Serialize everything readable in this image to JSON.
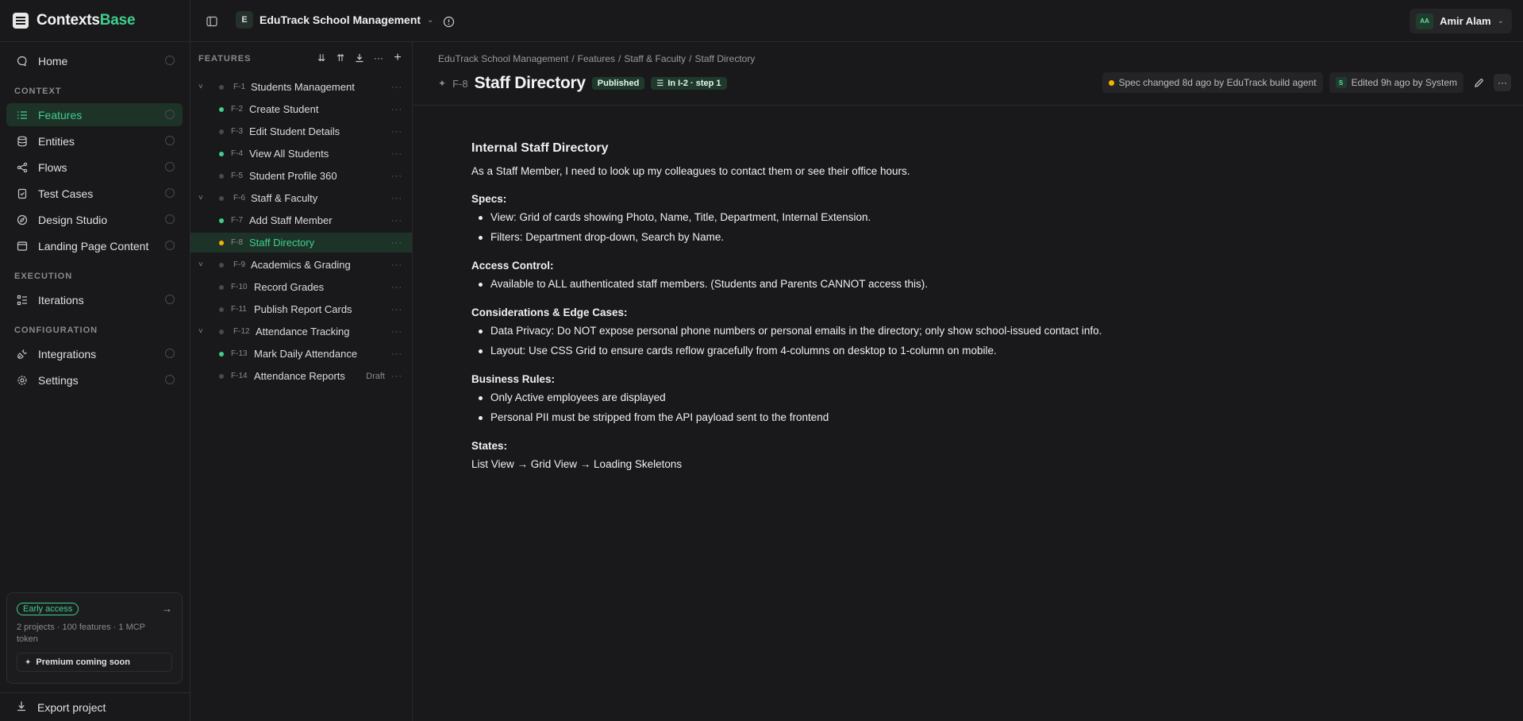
{
  "brand": {
    "name_main": "Contexts",
    "name_accent": "Base"
  },
  "project": {
    "badge": "E",
    "name": "EduTrack School Management"
  },
  "user": {
    "initials": "AA",
    "name": "Amir Alam"
  },
  "sidebar": {
    "home": "Home",
    "context_heading": "CONTEXT",
    "context_items": [
      "Features",
      "Entities",
      "Flows",
      "Test Cases",
      "Design Studio",
      "Landing Page Content"
    ],
    "execution_heading": "EXECUTION",
    "execution_items": [
      "Iterations"
    ],
    "configuration_heading": "CONFIGURATION",
    "configuration_items": [
      "Integrations",
      "Settings"
    ],
    "early_access": {
      "pill": "Early access",
      "desc": "2 projects · 100 features · 1 MCP token",
      "button": "Premium coming soon"
    },
    "export": "Export project"
  },
  "features": {
    "header": "FEATURES",
    "items": [
      {
        "id": "F-1",
        "name": "Students Management",
        "group": true,
        "status": "none"
      },
      {
        "id": "F-2",
        "name": "Create Student",
        "group": false,
        "status": "green"
      },
      {
        "id": "F-3",
        "name": "Edit Student Details",
        "group": false,
        "status": "none"
      },
      {
        "id": "F-4",
        "name": "View All Students",
        "group": false,
        "status": "green"
      },
      {
        "id": "F-5",
        "name": "Student Profile 360",
        "group": false,
        "status": "none"
      },
      {
        "id": "F-6",
        "name": "Staff & Faculty",
        "group": true,
        "status": "none"
      },
      {
        "id": "F-7",
        "name": "Add Staff Member",
        "group": false,
        "status": "green"
      },
      {
        "id": "F-8",
        "name": "Staff Directory",
        "group": false,
        "status": "yellow",
        "active": true
      },
      {
        "id": "F-9",
        "name": "Academics & Grading",
        "group": true,
        "status": "none"
      },
      {
        "id": "F-10",
        "name": "Record Grades",
        "group": false,
        "status": "none"
      },
      {
        "id": "F-11",
        "name": "Publish Report Cards",
        "group": false,
        "status": "none"
      },
      {
        "id": "F-12",
        "name": "Attendance Tracking",
        "group": true,
        "status": "none"
      },
      {
        "id": "F-13",
        "name": "Mark Daily Attendance",
        "group": false,
        "status": "green"
      },
      {
        "id": "F-14",
        "name": "Attendance Reports",
        "group": false,
        "status": "none",
        "draft": "Draft"
      }
    ]
  },
  "main": {
    "breadcrumb": [
      "EduTrack School Management",
      "/",
      "Features",
      "/",
      "Staff & Faculty",
      "/",
      "Staff Directory"
    ],
    "feature_id": "F-8",
    "title": "Staff Directory",
    "status_pill": "Published",
    "iteration_pill": "In I-2 · step 1",
    "spec_changed": "Spec changed 8d ago by EduTrack build agent",
    "edited_badge": "S",
    "edited": "Edited 9h ago by System",
    "doc": {
      "heading": "Internal Staff Directory",
      "intro": "As a Staff Member, I need to look up my colleagues to contact them or see their office hours.",
      "specs_title": "Specs:",
      "specs": [
        "View: Grid of cards showing Photo, Name, Title, Department, Internal Extension.",
        "Filters: Department drop-down, Search by Name."
      ],
      "access_title": "Access Control:",
      "access": [
        "Available to ALL authenticated staff members. (Students and Parents CANNOT access this)."
      ],
      "edge_title": "Considerations & Edge Cases:",
      "edge": [
        "Data Privacy: Do NOT expose personal phone numbers or personal emails in the directory; only show school-issued contact info.",
        "Layout: Use CSS Grid to ensure cards reflow gracefully from 4-columns on desktop to 1-column on mobile."
      ],
      "rules_title": "Business Rules:",
      "rules": [
        "Only Active employees are displayed",
        "Personal PII must be stripped from the API payload sent to the frontend"
      ],
      "states_title": "States:",
      "states": "List View → Grid View → Loading Skeletons"
    }
  },
  "colors": {
    "accent": "#3ecf8e",
    "warning": "#f5b301",
    "background": "#19191b"
  }
}
